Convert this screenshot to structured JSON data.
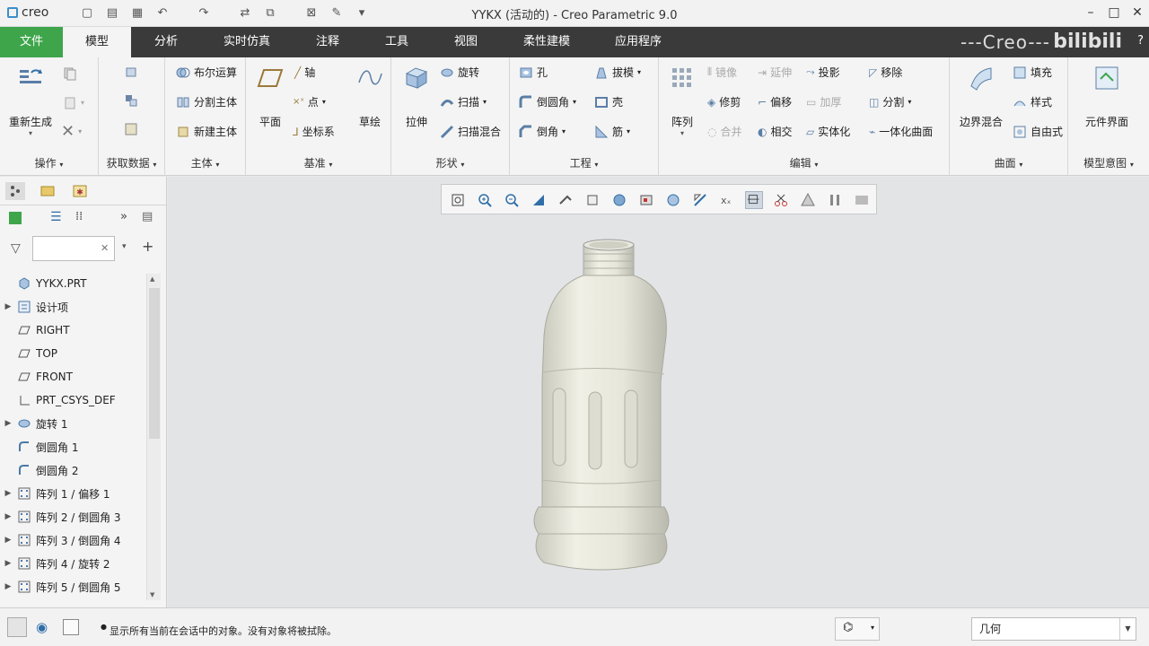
{
  "app": {
    "logo": "creo",
    "window_title": "YYKX (活动的) - Creo Parametric 9.0",
    "brand_watermark": "---Creo---",
    "help": "?"
  },
  "menu_tabs": [
    {
      "label": "文件"
    },
    {
      "label": "模型"
    },
    {
      "label": "分析"
    },
    {
      "label": "实时仿真"
    },
    {
      "label": "注释"
    },
    {
      "label": "工具"
    },
    {
      "label": "视图"
    },
    {
      "label": "柔性建模"
    },
    {
      "label": "应用程序"
    }
  ],
  "ribbon": {
    "operations": {
      "title": "操作",
      "regenerate": "重新生成"
    },
    "get_data": {
      "title": "获取数据"
    },
    "body": {
      "title": "主体",
      "boolean": "布尔运算",
      "split_body": "分割主体",
      "new_body": "新建主体"
    },
    "datum": {
      "title": "基准",
      "plane": "平面",
      "axis": "轴",
      "point": "点",
      "csys": "坐标系",
      "sketch": "草绘"
    },
    "shapes": {
      "title": "形状",
      "extrude": "拉伸",
      "revolve": "旋转",
      "sweep": "扫描",
      "swept_blend": "扫描混合"
    },
    "engineering": {
      "title": "工程",
      "hole": "孔",
      "round": "倒圆角",
      "chamfer": "倒角",
      "draft": "拔模",
      "shell": "壳",
      "rib": "筋"
    },
    "editing": {
      "title": "编辑",
      "pattern": "阵列",
      "mirror": "镜像",
      "extend": "延伸",
      "project": "投影",
      "remove": "移除",
      "trim": "修剪",
      "offset": "偏移",
      "thicken": "加厚",
      "split": "分割",
      "merge": "合并",
      "intersect": "相交",
      "solidify": "实体化",
      "unify": "一体化曲面"
    },
    "surfaces": {
      "title": "曲面",
      "boundary_blend": "边界混合",
      "fill": "填充",
      "style": "样式",
      "freestyle": "自由式"
    },
    "model_intent": {
      "title": "模型意图",
      "component_interface": "元件界面"
    }
  },
  "tree": {
    "filter_placeholder": "",
    "items": [
      {
        "label": "YYKX.PRT",
        "icon": "part-icon",
        "expand": false
      },
      {
        "label": "设计项",
        "icon": "design-items-icon",
        "expand": true
      },
      {
        "label": "RIGHT",
        "icon": "datum-plane-icon",
        "expand": false
      },
      {
        "label": "TOP",
        "icon": "datum-plane-icon",
        "expand": false
      },
      {
        "label": "FRONT",
        "icon": "datum-plane-icon",
        "expand": false
      },
      {
        "label": "PRT_CSYS_DEF",
        "icon": "csys-icon",
        "expand": false
      },
      {
        "label": "旋转 1",
        "icon": "revolve-icon",
        "expand": true
      },
      {
        "label": "倒圆角 1",
        "icon": "round-icon",
        "expand": false
      },
      {
        "label": "倒圆角 2",
        "icon": "round-icon",
        "expand": false
      },
      {
        "label": "阵列 1 / 偏移 1",
        "icon": "pattern-icon",
        "expand": true
      },
      {
        "label": "阵列 2 / 倒圆角 3",
        "icon": "pattern-icon",
        "expand": true
      },
      {
        "label": "阵列 3 / 倒圆角 4",
        "icon": "pattern-icon",
        "expand": true
      },
      {
        "label": "阵列 4 / 旋转 2",
        "icon": "pattern-icon",
        "expand": true
      },
      {
        "label": "阵列 5 / 倒圆角 5",
        "icon": "pattern-icon",
        "expand": true
      }
    ]
  },
  "status": {
    "message": "显示所有当前在会话中的对象。没有对象将被拭除。",
    "selection_filter": "几何"
  },
  "colors": {
    "file_tab": "#3ea54b",
    "tabbar": "#3a3a3a",
    "ribbon_bg": "#f4f4f4",
    "graphics_bg": "#e3e4e6",
    "model": "#e6e6dc"
  }
}
